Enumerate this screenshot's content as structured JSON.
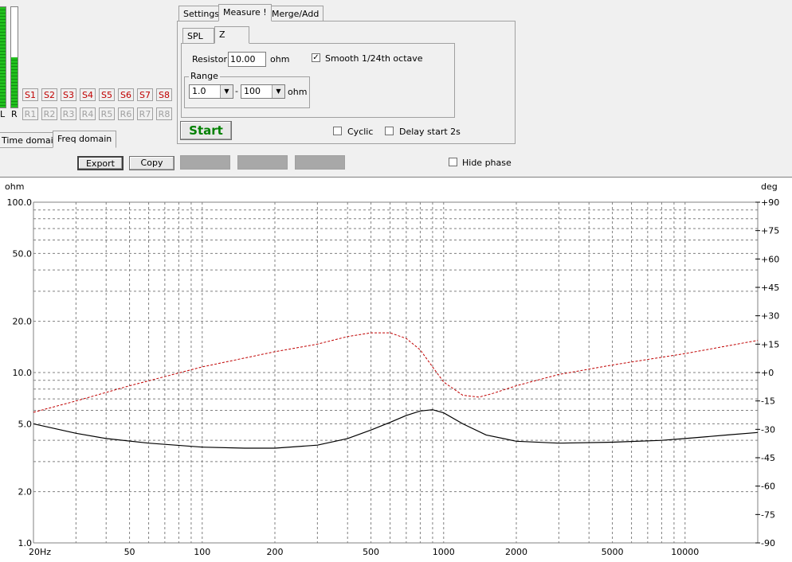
{
  "meters": {
    "left_label": "L",
    "right_label": "R",
    "left_level": 1.0,
    "right_level": 0.5
  },
  "store_buttons": [
    "S1",
    "S2",
    "S3",
    "S4",
    "S5",
    "S6",
    "S7",
    "S8"
  ],
  "recall_buttons": [
    "R1",
    "R2",
    "R3",
    "R4",
    "R5",
    "R6",
    "R7",
    "R8"
  ],
  "domain_tabs": {
    "time": "Time domain",
    "freq": "Freq domain"
  },
  "main_tabs": {
    "settings": "Settings",
    "measure": "Measure !",
    "merge": "Merge/Add"
  },
  "sub_tabs": {
    "spl": "SPL",
    "z": "Z"
  },
  "measure": {
    "resistor_label": "Resistor",
    "resistor_value": "10.00",
    "resistor_unit": "ohm",
    "smooth_label": "Smooth 1/24th octave",
    "smooth_checked": true,
    "range_label": "Range",
    "range_min": "1.0",
    "range_dash": "-",
    "range_max": "100",
    "range_unit": "ohm",
    "start_label": "Start",
    "cyclic_label": "Cyclic",
    "cyclic_checked": false,
    "delay_label": "Delay start 2s",
    "delay_checked": false
  },
  "toolbar": {
    "export_label": "Export",
    "copy_label": "Copy",
    "hide_phase_label": "Hide phase",
    "hide_phase_checked": false
  },
  "colors": {
    "magnitude": "#000000",
    "phase": "#c00000",
    "meter": "#22c01e",
    "start_text": "#008000",
    "store_text": "#c00000"
  },
  "chart_data": {
    "type": "line",
    "xscale": "log",
    "yscale": "log",
    "xlim": [
      20,
      20000
    ],
    "ylim": [
      1,
      100
    ],
    "y2lim": [
      -90,
      90
    ],
    "ylabel": "ohm",
    "y2label": "deg",
    "x_tick_labels": [
      {
        "value": 20,
        "label": "20Hz"
      },
      {
        "value": 50,
        "label": "50"
      },
      {
        "value": 100,
        "label": "100"
      },
      {
        "value": 200,
        "label": "200"
      },
      {
        "value": 500,
        "label": "500"
      },
      {
        "value": 1000,
        "label": "1000"
      },
      {
        "value": 2000,
        "label": "2000"
      },
      {
        "value": 5000,
        "label": "5000"
      },
      {
        "value": 10000,
        "label": "10000"
      }
    ],
    "y_tick_labels": [
      {
        "value": 100,
        "label": "100.0"
      },
      {
        "value": 50,
        "label": "50.0"
      },
      {
        "value": 20,
        "label": "20.0"
      },
      {
        "value": 10,
        "label": "10.0"
      },
      {
        "value": 5,
        "label": "5.0"
      },
      {
        "value": 2,
        "label": "2.0"
      },
      {
        "value": 1,
        "label": "1.0"
      }
    ],
    "y2_tick_labels": [
      {
        "value": 90,
        "label": "+90"
      },
      {
        "value": 75,
        "label": "+75"
      },
      {
        "value": 60,
        "label": "+60"
      },
      {
        "value": 45,
        "label": "+45"
      },
      {
        "value": 30,
        "label": "+30"
      },
      {
        "value": 15,
        "label": "+15"
      },
      {
        "value": 0,
        "label": "+0"
      },
      {
        "value": -15,
        "label": "-15"
      },
      {
        "value": -30,
        "label": "-30"
      },
      {
        "value": -45,
        "label": "-45"
      },
      {
        "value": -60,
        "label": "-60"
      },
      {
        "value": -75,
        "label": "-75"
      },
      {
        "value": -90,
        "label": "-90"
      }
    ],
    "grid": true,
    "series": [
      {
        "axis": "left",
        "points": [
          [
            20,
            5.0
          ],
          [
            30,
            4.4
          ],
          [
            40,
            4.1
          ],
          [
            60,
            3.85
          ],
          [
            100,
            3.65
          ],
          [
            150,
            3.6
          ],
          [
            200,
            3.6
          ],
          [
            300,
            3.75
          ],
          [
            400,
            4.1
          ],
          [
            500,
            4.6
          ],
          [
            600,
            5.1
          ],
          [
            700,
            5.6
          ],
          [
            800,
            5.95
          ],
          [
            900,
            6.05
          ],
          [
            1000,
            5.8
          ],
          [
            1200,
            5.0
          ],
          [
            1500,
            4.3
          ],
          [
            2000,
            3.95
          ],
          [
            3000,
            3.85
          ],
          [
            5000,
            3.9
          ],
          [
            8000,
            4.0
          ],
          [
            10000,
            4.1
          ],
          [
            15000,
            4.3
          ],
          [
            20000,
            4.45
          ]
        ]
      },
      {
        "axis": "right",
        "points": [
          [
            20,
            -21
          ],
          [
            30,
            -15
          ],
          [
            50,
            -7
          ],
          [
            100,
            3
          ],
          [
            200,
            11
          ],
          [
            300,
            15
          ],
          [
            400,
            19
          ],
          [
            500,
            21
          ],
          [
            600,
            21
          ],
          [
            700,
            18
          ],
          [
            800,
            12
          ],
          [
            900,
            3
          ],
          [
            1000,
            -5
          ],
          [
            1200,
            -12
          ],
          [
            1400,
            -13
          ],
          [
            1600,
            -11
          ],
          [
            2000,
            -7
          ],
          [
            3000,
            -1
          ],
          [
            5000,
            4
          ],
          [
            10000,
            10
          ],
          [
            20000,
            17
          ]
        ]
      }
    ]
  }
}
